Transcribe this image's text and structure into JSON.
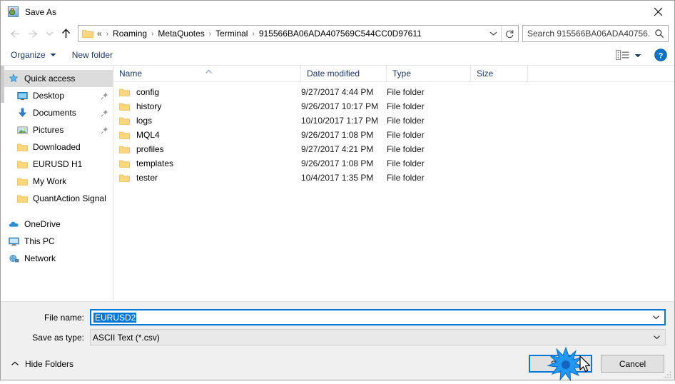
{
  "window": {
    "title": "Save As",
    "icon": "save-as-app-icon",
    "close_label": "✕"
  },
  "navigation": {
    "back_icon": "back-arrow-icon",
    "forward_icon": "forward-arrow-icon",
    "recent_icon": "recent-locations-chevron-icon",
    "up_icon": "up-arrow-icon",
    "address": {
      "folder_icon": "folder-icon",
      "lead": "«",
      "crumbs": [
        "Roaming",
        "MetaQuotes",
        "Terminal",
        "915566BA06ADA407569C544CC0D97611"
      ],
      "separator": "›",
      "dropdown_icon": "chevron-down-icon",
      "refresh_icon": "refresh-icon"
    },
    "search": {
      "placeholder": "Search 915566BA06ADA40756...",
      "icon": "search-icon"
    }
  },
  "toolbar": {
    "organize_label": "Organize",
    "organize_caret": "▾",
    "new_folder_label": "New folder",
    "view_icon": "view-layout-icon",
    "view_caret": "▾",
    "help_icon": "help-icon",
    "help_glyph": "?"
  },
  "sidebar": {
    "quick_access": {
      "label": "Quick access",
      "icon": "star-pin-icon",
      "selected": true
    },
    "pinned": [
      {
        "label": "Desktop",
        "icon": "desktop-icon",
        "pin": "pin-icon"
      },
      {
        "label": "Documents",
        "icon": "documents-download-icon",
        "pin": "pin-icon"
      },
      {
        "label": "Pictures",
        "icon": "pictures-icon",
        "pin": "pin-icon"
      }
    ],
    "folders": [
      {
        "label": "Downloaded",
        "icon": "folder-icon"
      },
      {
        "label": "EURUSD H1",
        "icon": "folder-icon"
      },
      {
        "label": "My Work",
        "icon": "folder-icon"
      },
      {
        "label": "QuantAction Signal",
        "icon": "folder-icon"
      }
    ],
    "roots": [
      {
        "label": "OneDrive",
        "icon": "onedrive-cloud-icon"
      },
      {
        "label": "This PC",
        "icon": "this-pc-icon"
      },
      {
        "label": "Network",
        "icon": "network-icon"
      }
    ]
  },
  "filelist": {
    "columns": [
      {
        "key": "name",
        "label": "Name",
        "sorted": "ascending",
        "sort_caret": "˄"
      },
      {
        "key": "date",
        "label": "Date modified"
      },
      {
        "key": "type",
        "label": "Type"
      },
      {
        "key": "size",
        "label": "Size"
      }
    ],
    "rows": [
      {
        "name": "config",
        "date": "9/27/2017 4:44 PM",
        "type": "File folder",
        "size": "",
        "icon": "folder-icon"
      },
      {
        "name": "history",
        "date": "9/26/2017 10:17 PM",
        "type": "File folder",
        "size": "",
        "icon": "folder-icon"
      },
      {
        "name": "logs",
        "date": "10/10/2017 1:17 PM",
        "type": "File folder",
        "size": "",
        "icon": "folder-icon"
      },
      {
        "name": "MQL4",
        "date": "9/26/2017 1:08 PM",
        "type": "File folder",
        "size": "",
        "icon": "folder-icon"
      },
      {
        "name": "profiles",
        "date": "9/27/2017 4:21 PM",
        "type": "File folder",
        "size": "",
        "icon": "folder-icon"
      },
      {
        "name": "templates",
        "date": "9/26/2017 1:08 PM",
        "type": "File folder",
        "size": "",
        "icon": "folder-icon"
      },
      {
        "name": "tester",
        "date": "10/4/2017 1:35 PM",
        "type": "File folder",
        "size": "",
        "icon": "folder-icon"
      }
    ]
  },
  "form": {
    "filename_label": "File name:",
    "filename_value": "EURUSD2",
    "filename_selected": true,
    "filetype_label": "Save as type:",
    "filetype_value": "ASCII Text (*.csv)",
    "dropdown_icon": "chevron-down-icon"
  },
  "actions": {
    "hide_folders_label": "Hide Folders",
    "hide_folders_caret": "˄",
    "save_label": "Save",
    "cancel_label": "Cancel",
    "save_is_default": true
  },
  "colors": {
    "accent": "#0078d7",
    "folder": "#fcd77c",
    "toolbar_text": "#1f3864",
    "selection": "#0078d7",
    "sidebar_selected": "#dcdcdc",
    "footer_bg": "#f0f0f0"
  }
}
